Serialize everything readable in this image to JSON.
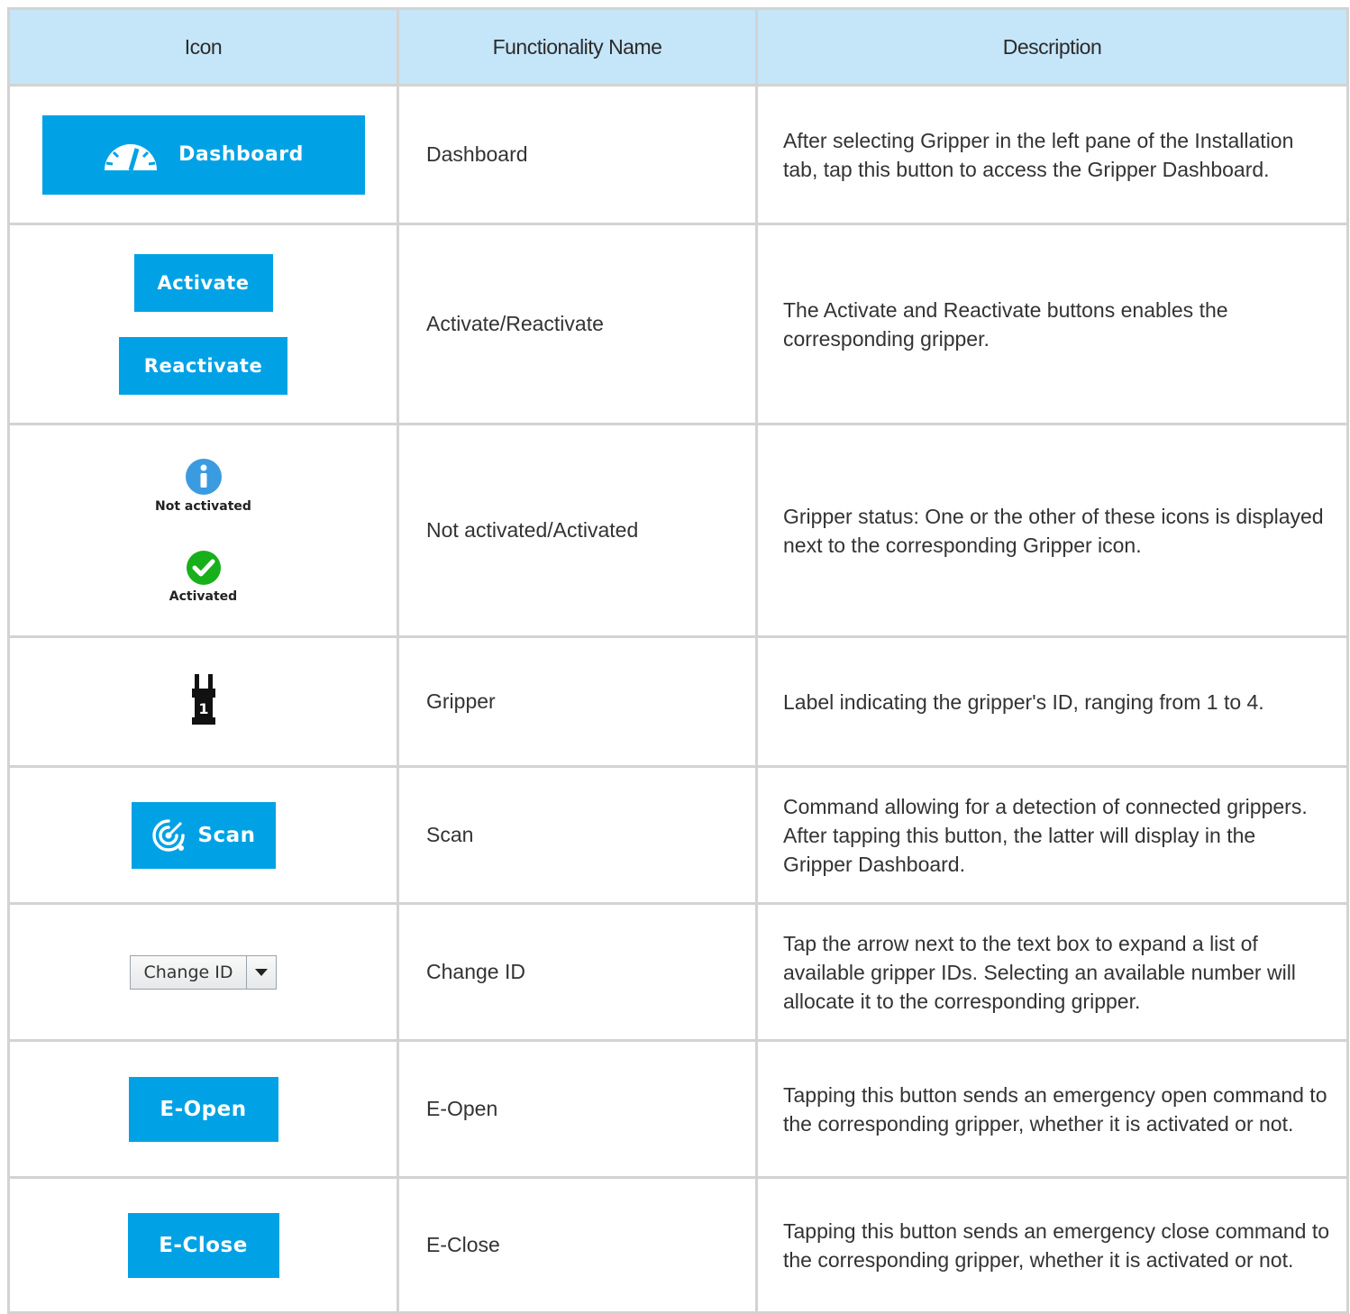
{
  "header": {
    "col_icon": "Icon",
    "col_name": "Functionality Name",
    "col_desc": "Description"
  },
  "rows": [
    {
      "button_label": "Dashboard",
      "name": "Dashboard",
      "description": "After selecting Gripper in the left pane of the Installation tab, tap this button to access the Gripper Dashboard."
    },
    {
      "button_label": "Activate",
      "button_label_2": "Reactivate",
      "name": "Activate/Reactivate",
      "description": "The Activate and Reactivate buttons enables the corresponding gripper."
    },
    {
      "status_label": "Not activated",
      "status_label_2": "Activated",
      "name": "Not activated/Activated",
      "description": "Gripper status: One or the other of these icons is displayed next to the corresponding Gripper icon."
    },
    {
      "icon_number": "1",
      "name": "Gripper",
      "description": "Label indicating the gripper's ID, ranging from 1 to 4."
    },
    {
      "button_label": "Scan",
      "name": "Scan",
      "description": "Command allowing for a detection of connected grippers. After tapping this button, the latter will display in the Gripper Dashboard."
    },
    {
      "select_value": "Change ID",
      "name": "Change ID",
      "description": "Tap the arrow next to the text box to expand a list of available gripper IDs. Selecting an available number will allocate it to the corresponding gripper."
    },
    {
      "button_label": "E-Open",
      "name": "E-Open",
      "description": "Tapping this button sends an emergency open command to the corresponding gripper, whether it is activated or not."
    },
    {
      "button_label": "E-Close",
      "name": "E-Close",
      "description": "Tapping this button sends an emergency close command to the corresponding gripper, whether it is activated or not."
    }
  ],
  "colors": {
    "button_blue": "#00a2e5",
    "header_bg": "#c5e5f9",
    "grid_line": "#d3d3d3",
    "info_blue": "#3b9be0",
    "ok_green": "#17b01b"
  },
  "icons": [
    "dashboard-gauge-icon",
    "info-icon",
    "check-icon",
    "gripper-icon",
    "scan-radar-icon",
    "dropdown-arrow-icon"
  ]
}
